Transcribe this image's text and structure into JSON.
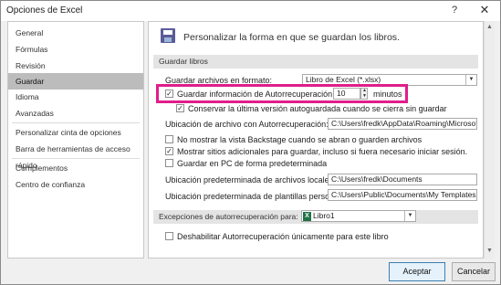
{
  "window": {
    "title": "Opciones de Excel",
    "help_glyph": "?",
    "close_glyph": "✕"
  },
  "sidebar": {
    "items": [
      {
        "label": "General"
      },
      {
        "label": "Fórmulas"
      },
      {
        "label": "Revisión"
      },
      {
        "label": "Guardar"
      },
      {
        "label": "Idioma"
      },
      {
        "label": "Avanzadas"
      },
      {
        "label": "Personalizar cinta de opciones"
      },
      {
        "label": "Barra de herramientas de acceso rápido"
      },
      {
        "label": "Complementos"
      },
      {
        "label": "Centro de confianza"
      }
    ],
    "selected": "Guardar"
  },
  "header": {
    "text": "Personalizar la forma en que se guardan los libros."
  },
  "guardar_libros": {
    "section_title": "Guardar libros",
    "format_label": "Guardar archivos en formato:",
    "format_value": "Libro de Excel (*.xlsx)",
    "autorecover_label": "Guardar información de Autorrecuperación cada",
    "autorecover_checked": true,
    "autorecover_minutes": "10",
    "minutes_label": "minutos",
    "keep_last_label": "Conservar la última versión autoguardada cuando se cierra sin guardar",
    "keep_last_checked": true,
    "autorecover_location_label": "Ubicación de archivo con Autorrecuperación:",
    "autorecover_location_value": "C:\\Users\\fredk\\AppData\\Roaming\\Microsoft\\",
    "no_backstage_label": "No mostrar la vista Backstage cuando se abran o guarden archivos",
    "no_backstage_checked": false,
    "show_more_places_label": "Mostrar sitios adicionales para guardar, incluso si fuera necesario iniciar sesión.",
    "show_more_places_checked": true,
    "save_to_pc_label": "Guardar en PC de forma predeterminada",
    "save_to_pc_checked": false,
    "local_files_label": "Ubicación predeterminada de archivos locales",
    "local_files_value": "C:\\Users\\fredk\\Documents",
    "templates_label": "Ubicación predeterminada de plantillas personales:",
    "templates_value": "C:\\Users\\Public\\Documents\\My Templates"
  },
  "excepciones": {
    "section_title": "Excepciones de autorrecuperación para:",
    "workbook_value": "Libro1",
    "disable_label": "Deshabilitar Autorrecuperación únicamente para este libro",
    "disable_checked": false
  },
  "footer": {
    "ok_label": "Aceptar",
    "cancel_label": "Cancelar"
  },
  "icons": {
    "save": "save-disk-icon",
    "excel": "excel-workbook-icon",
    "check": "✓"
  },
  "colors": {
    "highlight": "#e01d8b",
    "selected_nav": "#bcbcbc",
    "section_bg": "#e4e4e4"
  }
}
